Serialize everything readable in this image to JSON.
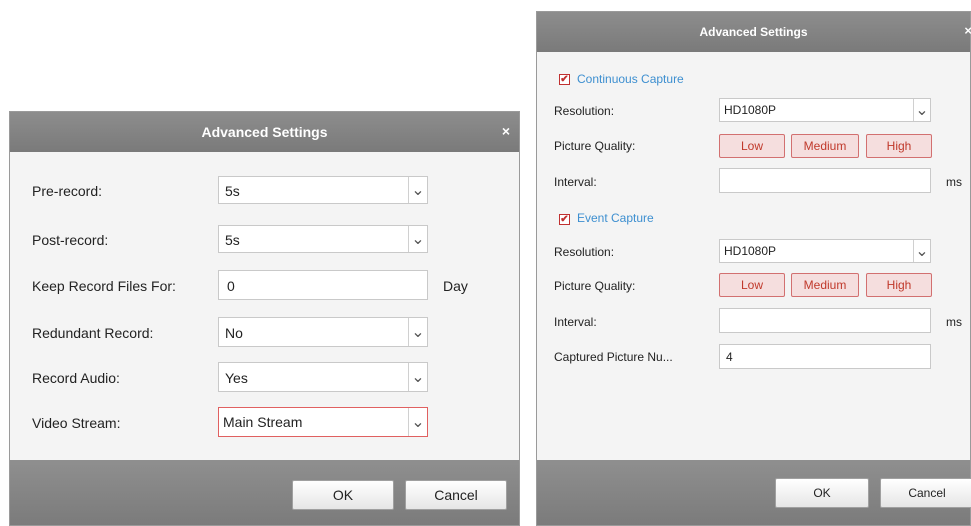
{
  "left_dialog": {
    "title": "Advanced Settings",
    "close": "×",
    "rows": [
      {
        "label": "Pre-record:",
        "value": "5s"
      },
      {
        "label": "Post-record:",
        "value": "5s"
      },
      {
        "label": "Keep Record Files For:",
        "value": "0",
        "unit": "Day"
      },
      {
        "label": "Redundant Record:",
        "value": "No"
      },
      {
        "label": "Record Audio:",
        "value": "Yes"
      },
      {
        "label": "Video Stream:",
        "value": "Main Stream"
      }
    ],
    "ok": "OK",
    "cancel": "Cancel"
  },
  "right_dialog": {
    "title": "Advanced Settings",
    "close": "×",
    "continuous": {
      "label": "Continuous Capture",
      "resolution_label": "Resolution:",
      "resolution": "HD1080P",
      "quality_label": "Picture Quality:",
      "quality_options": [
        "Low",
        "Medium",
        "High"
      ],
      "interval_label": "Interval:",
      "interval_value": "",
      "interval_unit": "ms"
    },
    "event": {
      "label": "Event Capture",
      "resolution_label": "Resolution:",
      "resolution": "HD1080P",
      "quality_label": "Picture Quality:",
      "quality_options": [
        "Low",
        "Medium",
        "High"
      ],
      "interval_label": "Interval:",
      "interval_value": "",
      "interval_unit": "ms",
      "captured_label": "Captured Picture Nu...",
      "captured_value": "4"
    },
    "ok": "OK",
    "cancel": "Cancel"
  },
  "icons": {
    "checkmark": "✔",
    "dropdown": "⌄"
  }
}
